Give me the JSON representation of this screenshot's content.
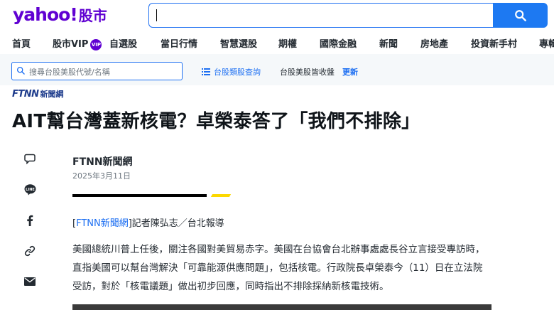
{
  "header": {
    "logo_brand": "yahoo!",
    "logo_section": "股市",
    "search_value": ""
  },
  "nav": {
    "items": [
      {
        "label": "首頁"
      },
      {
        "label": "股市VIP",
        "badge": "VIP"
      },
      {
        "label": "自選股"
      },
      {
        "label": "當日行情"
      },
      {
        "label": "智慧選股"
      },
      {
        "label": "期權"
      },
      {
        "label": "國際金融"
      },
      {
        "label": "新聞",
        "active": true
      },
      {
        "label": "房地產"
      },
      {
        "label": "投資新手村"
      },
      {
        "label": "專輯"
      }
    ]
  },
  "subbar": {
    "search_placeholder": "搜尋台股美股代號/名稱",
    "filter_label": "台股類股查詢",
    "status_text": "台股美股皆收盤",
    "refresh_label": "更新"
  },
  "article": {
    "source_logo": "FTNN",
    "source_logo_suffix": "新聞網",
    "headline": "AIT幫台灣蓋新核電？卓榮泰答了「我們不排除」",
    "author": "FTNN新聞網",
    "date": "2025年3月11日",
    "byline_prefix": "[",
    "byline_link": "FTNN新聞網",
    "byline_suffix": "]記者陳弘志／台北報導",
    "paragraph": "美國總統川普上任後，關注各國對美貿易赤字。美國在台協會台北辦事處處長谷立言接受專訪時，直指美國可以幫台灣解決「可靠能源供應問題」，包括核電。行政院長卓榮泰今（11）日在立法院受訪，對於「核電議題」做出初步回應，同時指出不排除採納新核電技術。"
  },
  "share_icons": [
    "comment-icon",
    "line-icon",
    "facebook-icon",
    "link-icon",
    "mail-icon"
  ],
  "colors": {
    "brand_purple": "#6001d2",
    "accent_blue": "#1d79f2",
    "divider_yellow": "#fcd800"
  }
}
